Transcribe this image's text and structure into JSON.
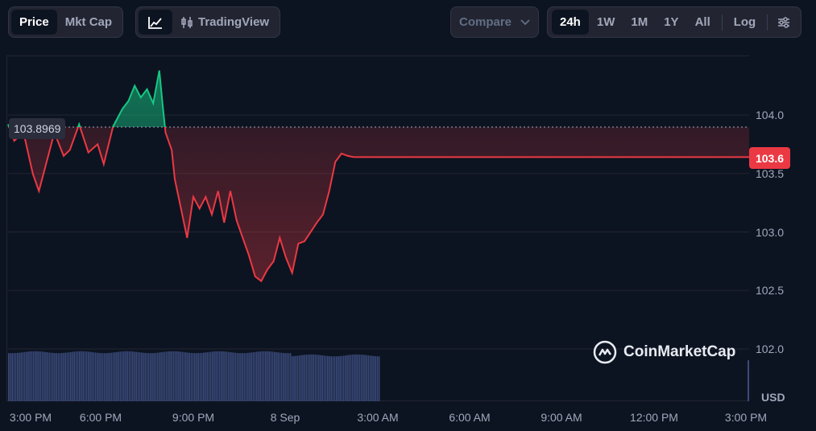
{
  "toolbar": {
    "metric_tabs": [
      {
        "label": "Price",
        "active": true
      },
      {
        "label": "Mkt Cap",
        "active": false
      }
    ],
    "chart_type": {
      "line_icon": "line-chart-icon",
      "tradingview_icon": "candlestick-icon",
      "tradingview_label": "TradingView"
    },
    "compare": {
      "label": "Compare",
      "icon": "chevron-down-icon"
    },
    "ranges": [
      {
        "label": "24h",
        "active": true
      },
      {
        "label": "1W",
        "active": false
      },
      {
        "label": "1M",
        "active": false
      },
      {
        "label": "1Y",
        "active": false
      },
      {
        "label": "All",
        "active": false
      }
    ],
    "log_label": "Log",
    "settings_icon": "sliders-icon"
  },
  "chart": {
    "reference_price": "103.8969",
    "current_price": "103.6",
    "currency": "USD",
    "watermark": "CoinMarketCap",
    "colors": {
      "up": "#16c784",
      "down": "#ea3943",
      "volume": "#3a4a7a"
    }
  },
  "chart_data": {
    "type": "line",
    "y_ticks": [
      "104.0",
      "103.5",
      "103.0",
      "102.5",
      "102.0"
    ],
    "x_ticks": [
      "3:00 PM",
      "6:00 PM",
      "9:00 PM",
      "8 Sep",
      "3:00 AM",
      "6:00 AM",
      "9:00 AM",
      "12:00 PM",
      "3:00 PM"
    ],
    "ylim": [
      101.8,
      104.45
    ],
    "reference": 103.8969,
    "x_hours": [
      0,
      0.2,
      0.5,
      0.8,
      1.0,
      1.2,
      1.5,
      1.8,
      2.0,
      2.3,
      2.6,
      2.9,
      3.1,
      3.4,
      3.7,
      3.9,
      4.1,
      4.3,
      4.5,
      4.7,
      4.9,
      5.0,
      5.1,
      5.3,
      5.4,
      5.6,
      5.8,
      6.0,
      6.2,
      6.4,
      6.6,
      6.8,
      7.0,
      7.2,
      7.4,
      7.6,
      7.8,
      8.0,
      8.2,
      8.4,
      8.6,
      8.8,
      9.0,
      9.2,
      9.4,
      9.6,
      9.8,
      10.0,
      10.2,
      10.4,
      10.6,
      10.8,
      11.0,
      11.2,
      11.4,
      11.6,
      11.8,
      12.0,
      12.2,
      24
    ],
    "values": [
      103.92,
      103.78,
      103.85,
      103.5,
      103.35,
      103.55,
      103.85,
      103.65,
      103.7,
      103.92,
      103.68,
      103.75,
      103.58,
      103.9,
      104.05,
      104.12,
      104.25,
      104.15,
      104.22,
      104.1,
      104.38,
      104.1,
      103.85,
      103.7,
      103.45,
      103.2,
      102.95,
      103.3,
      103.2,
      103.3,
      103.15,
      103.35,
      103.08,
      103.35,
      103.1,
      102.95,
      102.8,
      102.62,
      102.58,
      102.68,
      102.75,
      102.95,
      102.78,
      102.65,
      102.9,
      102.92,
      103.0,
      103.08,
      103.15,
      103.35,
      103.6,
      103.67,
      103.65,
      103.64,
      103.64,
      103.64,
      103.64,
      103.64,
      103.64,
      103.64
    ]
  }
}
